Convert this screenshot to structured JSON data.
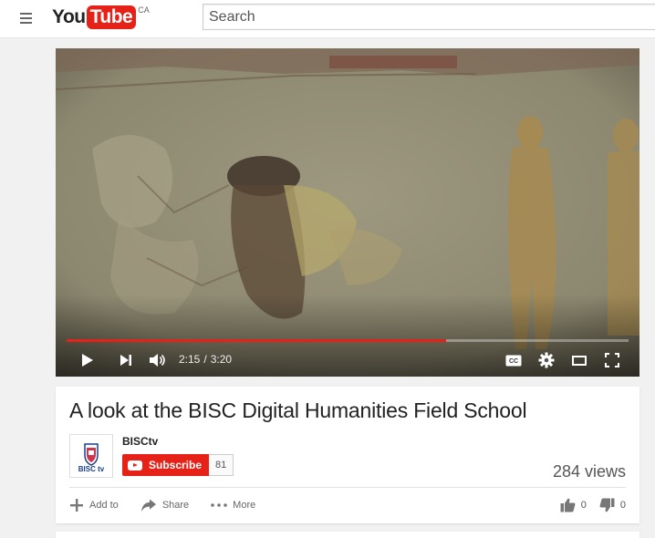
{
  "masthead": {
    "logo_you": "You",
    "logo_tube": "Tube",
    "logo_country": "CA",
    "search_placeholder": "Search"
  },
  "player": {
    "current_time": "2:15",
    "duration": "3:20",
    "time_separator": "/",
    "progress_fraction": 0.675,
    "progress_color": "#e62117",
    "icons": [
      "play-icon",
      "next-icon",
      "volume-icon",
      "captions-icon",
      "settings-icon",
      "theater-mode-icon",
      "fullscreen-icon"
    ]
  },
  "video": {
    "title": "A look at the BISC Digital Humanities Field School",
    "channel": {
      "name": "BISCtv",
      "avatar_text": "BISC tv"
    },
    "subscribe_label": "Subscribe",
    "subscriber_count": "81",
    "views": "284 views"
  },
  "actions": {
    "add_to": "Add to",
    "share": "Share",
    "more": "More",
    "likes": "0",
    "dislikes": "0"
  },
  "colors": {
    "brand_red": "#e62117",
    "page_bg": "#f1f1f1"
  }
}
